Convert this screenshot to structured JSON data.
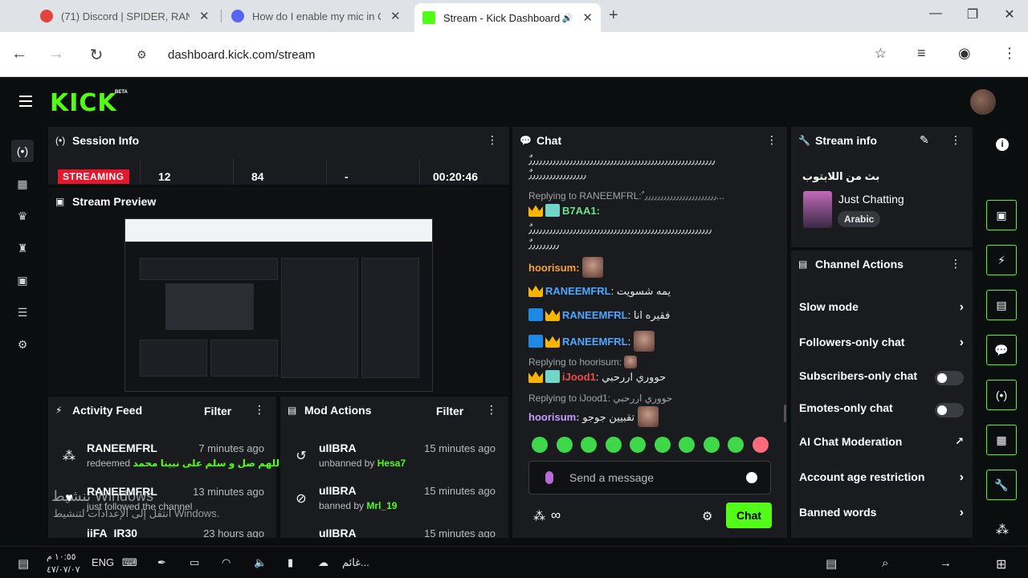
{
  "browser": {
    "tabs": [
      {
        "title": "(71) Discord | SPIDER, RANE",
        "active": false
      },
      {
        "title": "How do I enable my mic in C",
        "active": false
      },
      {
        "title": "Stream - Kick Dashboard",
        "active": true
      }
    ],
    "url": "dashboard.kick.com/stream"
  },
  "kick": {
    "logo": "KICK",
    "beta": "BETA"
  },
  "session": {
    "title": "Session Info",
    "status": "STREAMING",
    "stats": [
      "12",
      "84",
      "-",
      "00:20:46"
    ]
  },
  "preview": {
    "title": "Stream Preview"
  },
  "activity": {
    "title": "Activity Feed",
    "filter": "Filter",
    "items": [
      {
        "name": "RANEEMFRL",
        "time": "7 minutes ago",
        "action": "redeemed",
        "detail": "اللهم صل و سلم على نبينا محمد"
      },
      {
        "name": "RANEEMFRL",
        "time": "13 minutes ago",
        "action": "just followed the channel",
        "detail": ""
      },
      {
        "name": "iiFA_IR30",
        "time": "23 hours ago",
        "action": "",
        "detail": ""
      }
    ]
  },
  "mod": {
    "title": "Mod Actions",
    "filter": "Filter",
    "items": [
      {
        "name": "uIIBRA",
        "time": "15 minutes ago",
        "action": "unbanned by",
        "by": "Hesa7"
      },
      {
        "name": "uIIBRA",
        "time": "15 minutes ago",
        "action": "banned by",
        "by": "Mrl_19"
      },
      {
        "name": "uIIBRA",
        "time": "15 minutes ago",
        "action": "",
        "by": ""
      }
    ]
  },
  "chat": {
    "title": "Chat",
    "lines": {
      "l1": "ٌ٫٫٫٫٫٫٫٫٫٫٫٫٫٫٫٫٫٫٫٫٫٫٫٫٫٫٫٫٫٫٫٫٫٫٫٫٫٫٫٫٫٫٫٫٫٫٫٫٫٫٫٫٫٫٫",
      "l2": "ٌ٫٫٫٫٫٫٫٫٫٫٫٫٫٫٫٫٫",
      "reply1": "Replying to RANEEMFRL: ٌ٫٫٫٫٫٫٫٫٫٫٫٫٫٫٫٫٫٫٫٫٫٫٫...",
      "u1": "B7AA1:",
      "l3": "ٌ٫٫٫٫٫٫٫٫٫٫٫٫٫٫٫٫٫٫٫٫٫٫٫٫٫٫٫٫٫٫٫٫٫٫٫٫٫٫٫٫٫٫٫٫٫٫٫٫٫٫٫٫٫٫",
      "l4": "ٌ٫٫٫٫٫٫٫٫٫",
      "u2": "hoorisum:",
      "u3": "RANEEMFRL",
      "m3": ": يمه شسويت",
      "u4": "RANEEMFRL",
      "m4": ": فقيره انا",
      "u5": "RANEEMFRL",
      "m5": ":",
      "reply2": "Replying to hoorisum:",
      "u6": "iJood1",
      "m6": ": حووري اررحبي",
      "reply3": "Replying to iJood1: حووري اررحبي",
      "u7": "hoorisum:",
      "m7": "تقبيين جوجو"
    },
    "placeholder": "Send a message",
    "button": "Chat"
  },
  "streaminfo": {
    "title": "Stream info",
    "stream_title": "بث من اللابتوب",
    "category": "Just Chatting",
    "language": "Arabic"
  },
  "actions": {
    "title": "Channel Actions",
    "items": [
      {
        "label": "Slow mode",
        "kind": "chevron"
      },
      {
        "label": "Followers-only chat",
        "kind": "chevron"
      },
      {
        "label": "Subscribers-only chat",
        "kind": "toggle"
      },
      {
        "label": "Emotes-only chat",
        "kind": "toggle"
      },
      {
        "label": "AI Chat Moderation",
        "kind": "external"
      },
      {
        "label": "Account age restriction",
        "kind": "chevron"
      },
      {
        "label": "Banned words",
        "kind": "chevron"
      }
    ]
  },
  "watermark": {
    "line1": "تنشيط Windows",
    "line2": "انتقل إلى الإعدادات لتنشيط Windows."
  },
  "taskbar": {
    "lang": "ENG",
    "weather": "غائم...",
    "time": "١٠:٥٥ م",
    "date": "٤٧/٠٧/٠٧"
  },
  "colors": {
    "accent": "#53fc18",
    "live": "#e5172d",
    "panel": "#191b1f",
    "bg": "#0b0e0f"
  }
}
